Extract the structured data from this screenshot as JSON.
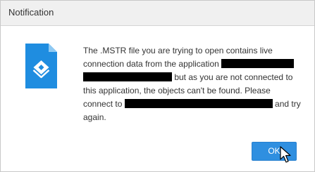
{
  "dialog": {
    "title": "Notification",
    "message": {
      "part1": "The .MSTR file you are trying to open contains live connection data from the application ",
      "part2": " but as you are not connected to this application, the objects can't be found. Please connect to ",
      "part3": " and try again."
    },
    "ok_label": "OK"
  },
  "icons": {
    "file": "mstr-file-icon",
    "cursor": "mouse-pointer-icon"
  },
  "colors": {
    "accent": "#2f8fe0",
    "icon_blue": "#1f8de0",
    "redaction": "#000000"
  }
}
